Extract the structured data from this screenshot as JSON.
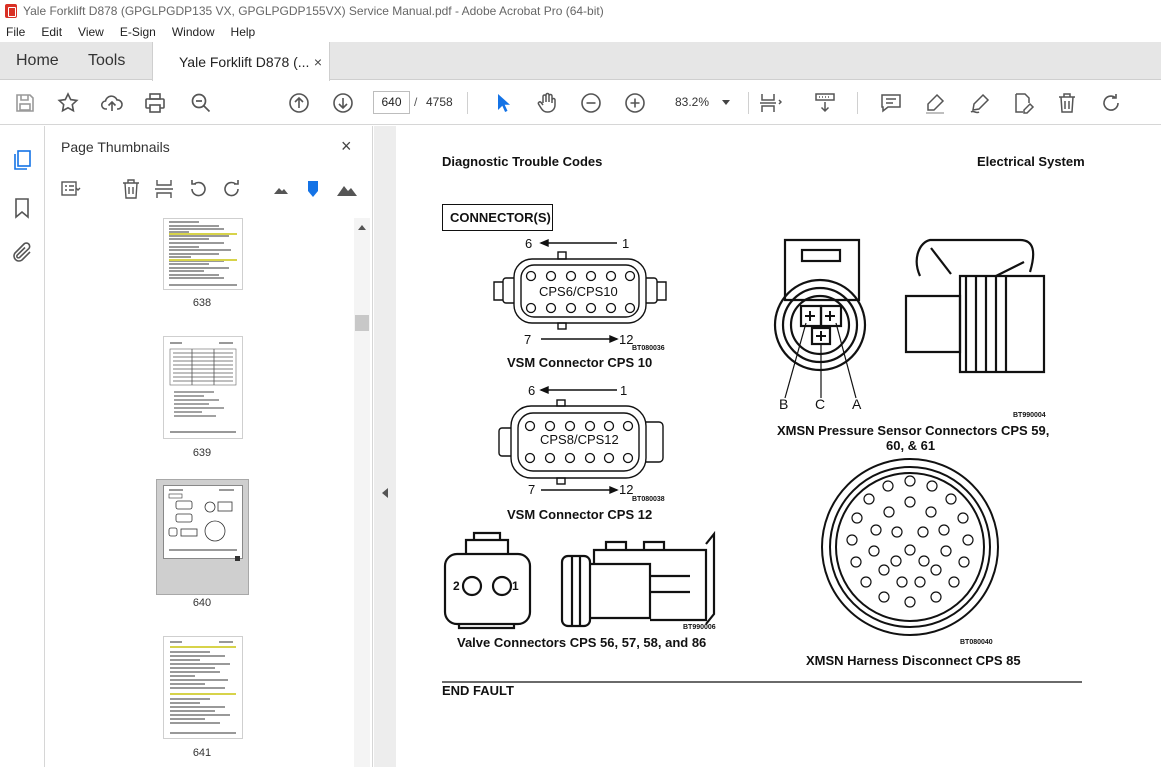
{
  "window": {
    "title": "Yale Forklift D878 (GPGLPGDP135 VX, GPGLPGDP155VX) Service Manual.pdf - Adobe Acrobat Pro (64-bit)"
  },
  "menu": [
    "File",
    "Edit",
    "View",
    "E-Sign",
    "Window",
    "Help"
  ],
  "tabs": {
    "home": "Home",
    "tools": "Tools",
    "document": "Yale Forklift D878 (...",
    "close": "×"
  },
  "toolbar": {
    "current_page": "640",
    "page_sep": "/",
    "total_pages": "4758",
    "zoom": "83.2%"
  },
  "thumbnail_panel": {
    "title": "Page Thumbnails",
    "close": "×",
    "pages": [
      "638",
      "639",
      "640",
      "641"
    ],
    "selected": "640"
  },
  "document": {
    "header_left": "Diagnostic Trouble Codes",
    "header_right": "Electrical System",
    "section_box": "CONNECTOR(S)",
    "cps10": {
      "pin_first": "6",
      "pin_last": "1",
      "pin_bottom_left": "7",
      "pin_bottom_right": "12",
      "label": "CPS6/CPS10",
      "code": "BT080036",
      "caption": "VSM Connector CPS 10"
    },
    "cps12": {
      "pin_first": "6",
      "pin_last": "1",
      "pin_bottom_left": "7",
      "pin_bottom_right": "12",
      "label": "CPS8/CPS12",
      "code": "BT080038",
      "caption": "VSM Connector CPS 12"
    },
    "valve": {
      "pin_left": "2",
      "pin_right": "1",
      "code": "BT990006",
      "caption": "Valve Connectors CPS 56, 57, 58, and 86"
    },
    "pressure": {
      "pin_b": "B",
      "pin_c": "C",
      "pin_a": "A",
      "code": "BT990004",
      "caption_line1": "XMSN Pressure Sensor Connectors CPS 59,",
      "caption_line2": "60, & 61"
    },
    "harness": {
      "code": "BT080040",
      "caption": "XMSN Harness Disconnect CPS 85"
    },
    "footer": "END FAULT"
  }
}
